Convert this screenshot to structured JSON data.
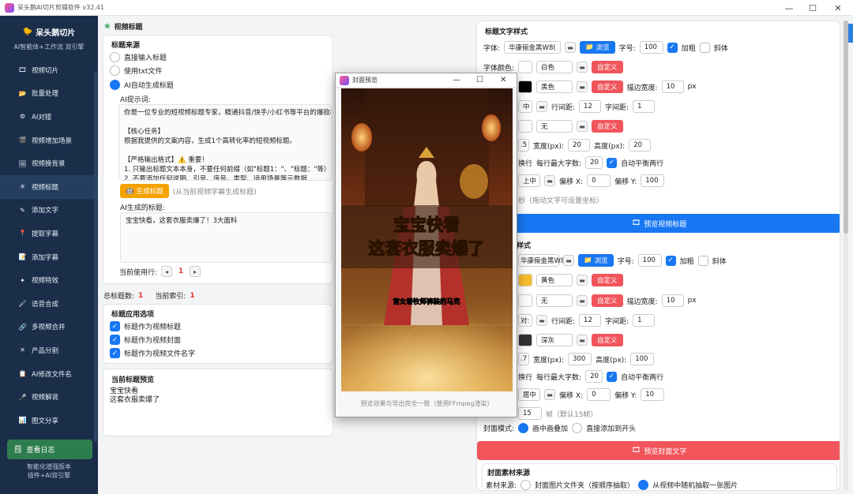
{
  "window": {
    "title": "呆头鹅AI切片剪辑软件 v32.41",
    "controls": {
      "minimize": "—",
      "maximize": "☐",
      "close": "✕"
    }
  },
  "sidebar": {
    "brand_title": "呆头鹅切片",
    "brand_subtitle": "AI智能体+工作流 双引擎",
    "items": [
      {
        "label": "视频切片",
        "icon": "film-icon"
      },
      {
        "label": "批量处理",
        "icon": "folder-icon"
      },
      {
        "label": "AI对接",
        "icon": "gear-icon"
      },
      {
        "label": "视频增加场景",
        "icon": "clapper-icon"
      },
      {
        "label": "视频换背景",
        "icon": "image-icon"
      },
      {
        "label": "视频标题",
        "icon": "sparkle-icon"
      },
      {
        "label": "添加文字",
        "icon": "pencil-icon"
      },
      {
        "label": "提取字幕",
        "icon": "pin-icon"
      },
      {
        "label": "添加字幕",
        "icon": "note-icon"
      },
      {
        "label": "视频特效",
        "icon": "star-icon"
      },
      {
        "label": "语音合成",
        "icon": "brush-icon"
      },
      {
        "label": "多视频合并",
        "icon": "link-icon"
      },
      {
        "label": "产品分割",
        "icon": "cross-icon"
      },
      {
        "label": "AI修改文件名",
        "icon": "rename-icon"
      },
      {
        "label": "视频解说",
        "icon": "mic-icon"
      },
      {
        "label": "图文分享",
        "icon": "share-icon"
      }
    ],
    "log_button": "查看日志",
    "footer_line1": "智能化增强版本",
    "footer_line2": "插件+AI双引擎"
  },
  "left": {
    "section_title": "视频标题",
    "source": {
      "header": "标题来源",
      "option_direct": "直接输入标题",
      "option_txt": "使用txt文件",
      "option_ai": "AI自动生成标题"
    },
    "prompt_label": "AI提示词:",
    "prompt_lines": [
      "你是一位专业的短视频标题专家，精通抖音/快手/小红书等平台的爆款标",
      "",
      "【核心任务】",
      "根据我提供的文案内容，生成1个高转化率的短视频标题。",
      "",
      "【严格输出格式】⚠️ 重要！",
      "1. 只输出标题文本本身，不要任何前缀（如\"标题1：\"、\"标题：\"等）",
      "2. 不要添加任何说明、引号、序号、类型、适用场景等元数据"
    ],
    "generate_button": "生成标题",
    "generate_hint": "(从当前视频字幕生成标题)",
    "generated_label": "AI生成的标题:",
    "generated_text": "宝宝快看，这套衣服卖爆了！3大面料",
    "current_row_label": "当前使用行:",
    "current_row_value": "1",
    "total_label": "总标题数:",
    "total_value": "1",
    "index_label": "当前索引:",
    "index_value": "1",
    "apply": {
      "header": "标题应用选项",
      "opt1": "标题作为视频标题",
      "opt2": "标题作为视频封面",
      "opt3": "标题作为视频文件名字"
    },
    "preview": {
      "header": "当前标题预览",
      "line1": "宝宝快看",
      "line2": "这套衣服卖爆了"
    }
  },
  "popup": {
    "title": "封面预览",
    "headline1": "宝宝快看",
    "headline2": "这套衣服卖爆了",
    "subline": "宫女着牧师裤装的马克",
    "note": "预览效果与导出完全一致（使用FFmpeg渲染）",
    "controls": {
      "minimize": "—",
      "maximize": "☐",
      "close": "✕"
    }
  },
  "right": {
    "title_style": {
      "header": "标题文字样式",
      "font_label": "字体:",
      "font_value": "华康俪金黑W8(",
      "browse": "浏览",
      "size_label": "字号:",
      "size_value": "100",
      "bold": "加粗",
      "italic": "斜体",
      "color_label": "字体颜色:",
      "color_value": "白色",
      "custom": "自定义",
      "stroke_value": "黑色",
      "stroke_width_label": "描边宽度:",
      "stroke_width_value": "10",
      "px": "px",
      "align_value": "中",
      "line_spacing_label": "行间距:",
      "line_spacing_value": "12",
      "char_spacing_label": "字间距:",
      "char_spacing_value": "1",
      "bg_value": "无",
      "bg_alpha": ".5",
      "width_label": "宽度(px):",
      "width_value": "20",
      "height_label": "高度(px):",
      "height_value": "20",
      "wrap_label": "换行",
      "max_chars_label": "每行最大字数:",
      "max_chars_value": "20",
      "balance_label": "自动平衡两行",
      "position_value": "上中",
      "offset_x_label": "偏移 X:",
      "offset_x_value": "0",
      "offset_y_label": "偏移 Y:",
      "offset_y_value": "100",
      "seconds_hint": "秒（拖动文字可设置坐标）"
    },
    "preview_video_button": "预览视频标题",
    "cover_style": {
      "header_tail": "样式",
      "font_value": "华康俪金黑W8(",
      "browse": "浏览",
      "size_label": "字号:",
      "size_value": "100",
      "bold": "加粗",
      "italic": "斜体",
      "color_value": "黄色",
      "custom": "自定义",
      "stroke_value": "无",
      "stroke_width_label": "描边宽度:",
      "stroke_width_value": "10",
      "px": "px",
      "align_value": "对:",
      "line_spacing_label": "行间距:",
      "line_spacing_value": "12",
      "char_spacing_label": "字间距:",
      "char_spacing_value": "1",
      "bg_value": "深灰",
      "bg_alpha": ".7",
      "width_label": "宽度(px):",
      "width_value": "300",
      "height_label": "高度(px):",
      "height_value": "100",
      "wrap_label": "换行",
      "max_chars_label": "每行最大字数:",
      "max_chars_value": "20",
      "balance_label": "自动平衡两行",
      "position_value": "居中",
      "offset_x_label": "偏移 X:",
      "offset_x_value": "0",
      "offset_y_label": "偏移 Y:",
      "offset_y_value": "10",
      "frames_value": "15",
      "frames_hint": "帧（默认15帧）"
    },
    "cover_mode_label": "封面模式:",
    "cover_mode_opt1": "画中画叠加",
    "cover_mode_opt2": "直接添加到开头",
    "preview_cover_button": "预览封面文字",
    "material": {
      "header": "封面素材来源",
      "label": "素材来源:",
      "opt1": "封面图片文件夹（按顺序抽取）",
      "opt2": "从视频中随机抽取一张图片"
    }
  }
}
